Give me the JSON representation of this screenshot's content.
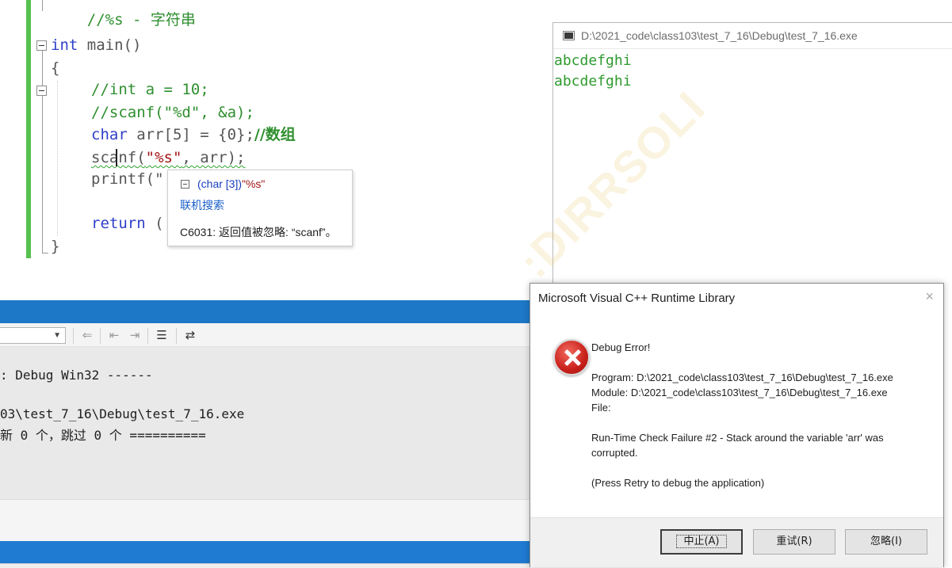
{
  "editor": {
    "lines": {
      "top_comment": "//%s - 字符串",
      "main_kw": "int",
      "main_rest": " main()",
      "open_brace": "{",
      "c1": "//int a = 10;",
      "c2": "//scanf(\"%d\", &a);",
      "decl_kw": "char",
      "decl_rest": " arr[5] = {0};",
      "decl_comment": "//数组",
      "scanf_fn": "scanf",
      "scanf_args_open": "(",
      "scanf_str": "\"%s\"",
      "scanf_args_close": ", arr);",
      "printf_text": "printf(\"",
      "return_kw": "return",
      "return_rest": " (",
      "close_brace": "}"
    },
    "tooltip": {
      "signature_type": "(char [3])",
      "signature_str": "\"%s\"",
      "search_link": "联机搜索",
      "warning": "C6031: 返回值被忽略: “scanf”。"
    }
  },
  "output_panel": {
    "lines": [
      ": Debug Win32 ------",
      "03\\test_7_16\\Debug\\test_7_16.exe",
      "新 0 个，跳过 0 个 =========="
    ]
  },
  "console": {
    "title": "D:\\2021_code\\class103\\test_7_16\\Debug\\test_7_16.exe",
    "output": [
      "abcdefghi",
      "abcdefghi"
    ]
  },
  "watermark": ":DIRRSOLI",
  "dialog": {
    "title": "Microsoft Visual C++ Runtime Library",
    "close": "×",
    "heading": "Debug Error!",
    "program": "Program: D:\\2021_code\\class103\\test_7_16\\Debug\\test_7_16.exe",
    "module": "Module: D:\\2021_code\\class103\\test_7_16\\Debug\\test_7_16.exe",
    "file": "File:",
    "message_line1": "Run-Time Check Failure #2 - Stack around the variable 'arr' was",
    "message_line2": "corrupted.",
    "hint": "(Press Retry to debug the application)",
    "buttons": {
      "abort": "中止(A)",
      "retry": "重试(R)",
      "ignore": "忽略(I)"
    }
  }
}
